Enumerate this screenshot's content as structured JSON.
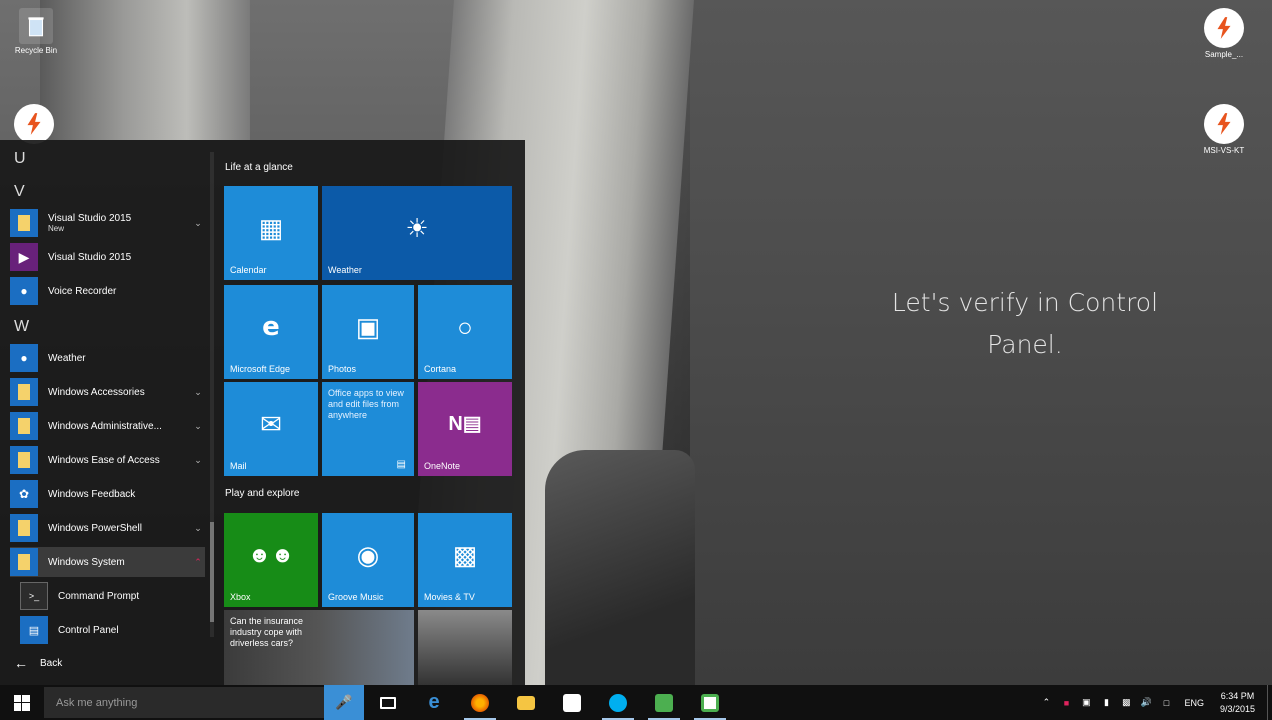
{
  "desktop": {
    "overlay_text": "Let's verify in Control Panel.",
    "icons": {
      "recycle": "Recycle Bin",
      "top_right": "Sample_...",
      "mid_right": "MSI-VS-KT"
    }
  },
  "start_menu": {
    "letters": {
      "u": "U",
      "v": "V",
      "w": "W"
    },
    "apps": [
      {
        "name": "Visual Studio 2015",
        "sub": "New"
      },
      {
        "name": "Visual Studio 2015"
      },
      {
        "name": "Voice Recorder"
      },
      {
        "name": "Weather"
      },
      {
        "name": "Windows Accessories"
      },
      {
        "name": "Windows Administrative..."
      },
      {
        "name": "Windows Ease of Access"
      },
      {
        "name": "Windows Feedback"
      },
      {
        "name": "Windows PowerShell"
      },
      {
        "name": "Windows System"
      },
      {
        "name": "Command Prompt"
      },
      {
        "name": "Control Panel"
      }
    ],
    "back": "Back",
    "groups": {
      "life": "Life at a glance",
      "play": "Play and explore"
    },
    "tiles": {
      "calendar": "Calendar",
      "weather": "Weather",
      "edge": "Microsoft Edge",
      "photos": "Photos",
      "cortana": "Cortana",
      "mail": "Mail",
      "office": "Office apps to view and edit files from anywhere",
      "onenote": "OneNote",
      "xbox": "Xbox",
      "groove": "Groove Music",
      "movies": "Movies & TV",
      "news": "Can the insurance industry cope with driverless cars?"
    }
  },
  "taskbar": {
    "search_placeholder": "Ask me anything",
    "lang": "ENG",
    "time": "6:34 PM",
    "date": "9/3/2015"
  },
  "colors": {
    "tile_blue": "#1e8cd8",
    "tile_dark_blue": "#0c5aa8",
    "onenote_purple": "#8b2c8e",
    "xbox_green": "#178c17",
    "cortana_blue": "#3a8fd6"
  }
}
